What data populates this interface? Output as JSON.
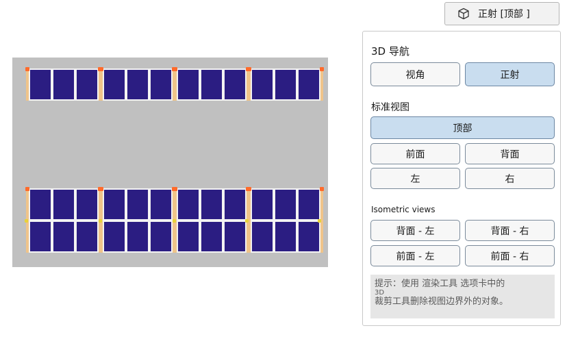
{
  "toolbar": {
    "view_toggle_label": "正射 [顶部 ]",
    "view_toggle_icon": "cube-icon"
  },
  "viewport": {
    "background": "#c0c0c0",
    "panel_color": "#2b1d82"
  },
  "nav_panel": {
    "title": "3D 导航",
    "projection": {
      "perspective_label": "视角",
      "orthographic_label": "正射",
      "active": "orthographic"
    },
    "standard_views": {
      "label": "标准视图",
      "top_label": "顶部",
      "front_label": "前面",
      "back_label": "背面",
      "left_label": "左",
      "right_label": "右",
      "active": "top"
    },
    "isometric_views": {
      "label": "Isometric views",
      "back_left_label": "背面 - 左",
      "back_right_label": "背面 - 右",
      "front_left_label": "前面 - 左",
      "front_right_label": "前面 - 右"
    },
    "hint": {
      "line1": "提示：使用 渲染工具 选项卡中的",
      "line2": "3D",
      "line3": "裁剪工具删除视图边界外的对象。"
    }
  },
  "colors": {
    "accent_active": "#c9ddef",
    "panel_blue": "#2b1d82",
    "frame_orange": "#f0c48a"
  }
}
